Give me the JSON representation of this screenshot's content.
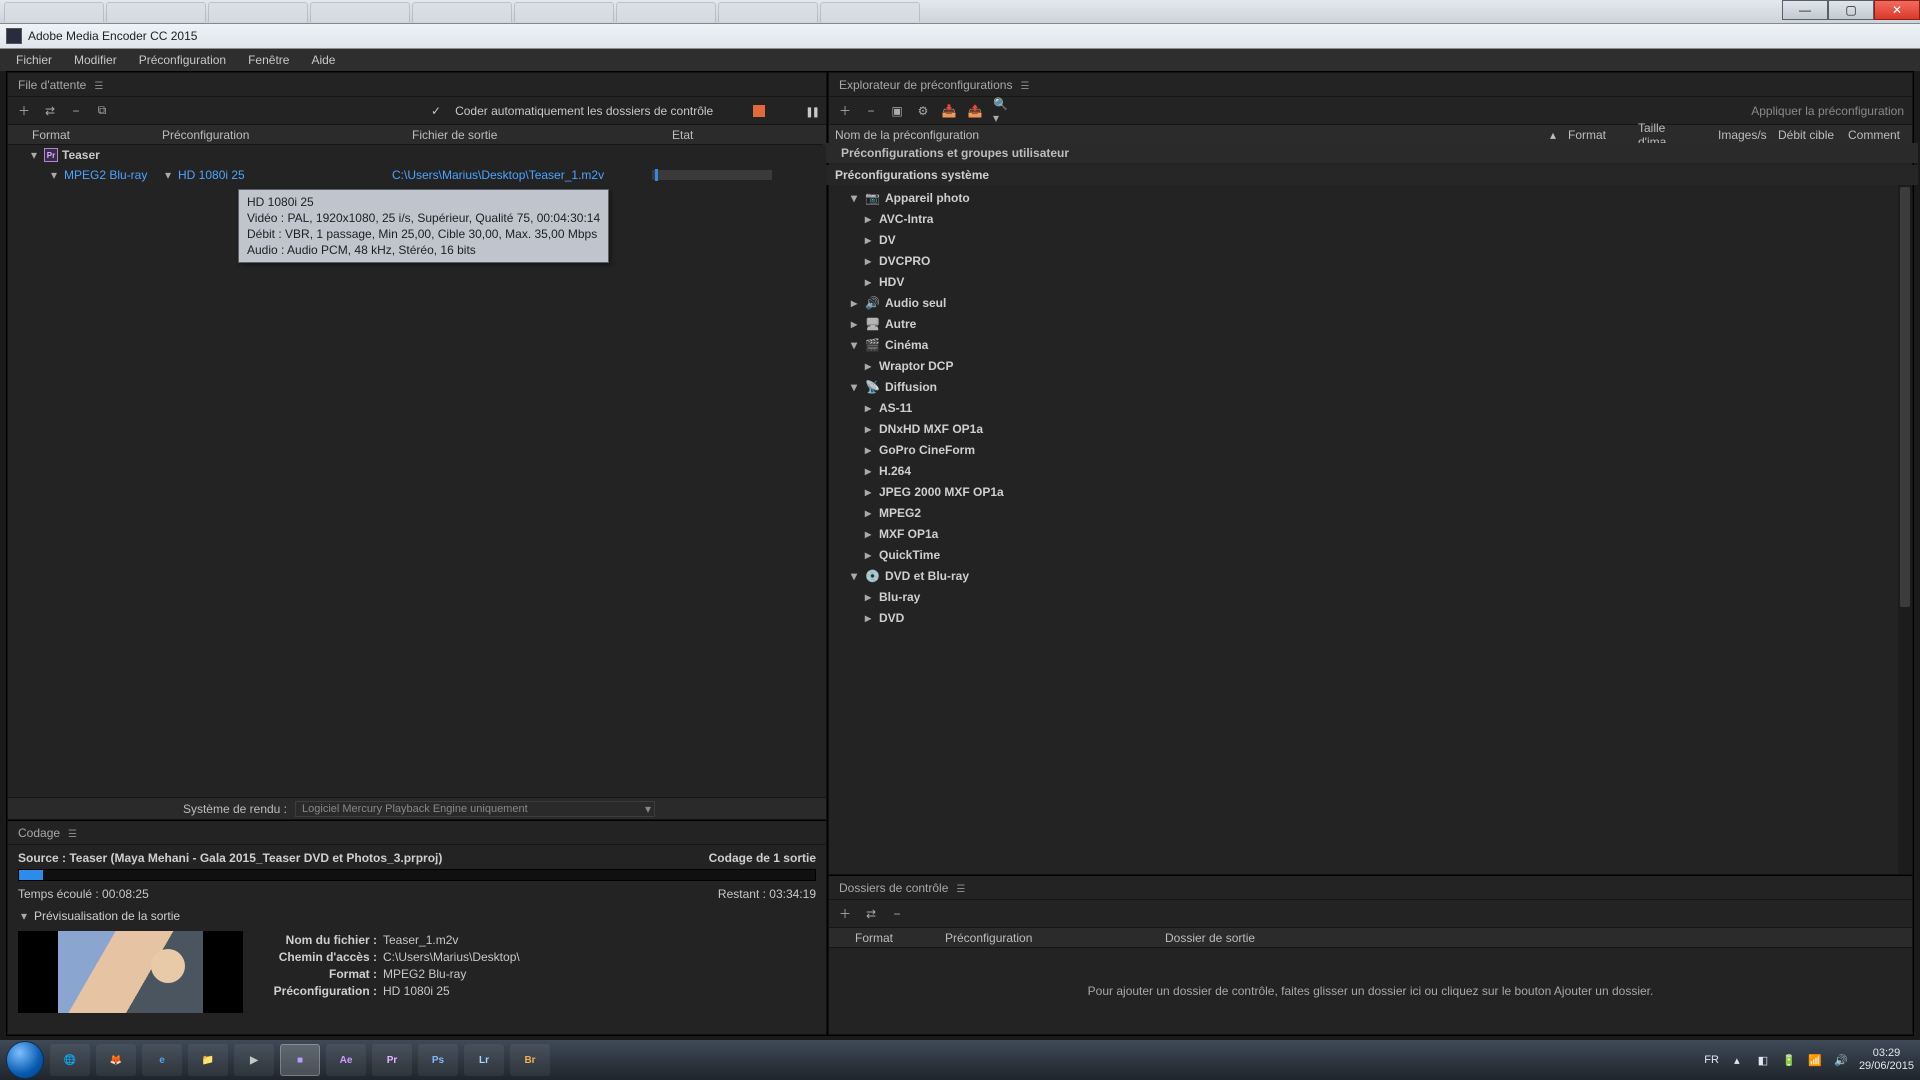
{
  "titlebar": {
    "title": "Adobe Media Encoder CC 2015"
  },
  "menubar": {
    "items": [
      "Fichier",
      "Modifier",
      "Préconfiguration",
      "Fenêtre",
      "Aide"
    ]
  },
  "queue": {
    "panel_title": "File d'attente",
    "auto_encode_label": "Coder automatiquement les dossiers de contrôle",
    "columns": {
      "format": "Format",
      "preset": "Préconfiguration",
      "output": "Fichier de sortie",
      "state": "Etat"
    },
    "item": {
      "name": "Teaser",
      "format": "MPEG2 Blu-ray",
      "preset": "HD 1080i 25",
      "output": "C:\\Users\\Marius\\Desktop\\Teaser_1.m2v"
    },
    "tooltip": {
      "l1": "HD 1080i 25",
      "l2": "Vidéo : PAL, 1920x1080, 25 i/s, Supérieur, Qualité  75, 00:04:30:14",
      "l3": "Débit : VBR, 1 passage, Min 25,00, Cible 30,00, Max. 35,00 Mbps",
      "l4": "Audio : Audio PCM, 48 kHz, Stéréo, 16 bits"
    },
    "render_label": "Système de rendu :",
    "render_value": "Logiciel Mercury Playback Engine uniquement"
  },
  "encoding": {
    "panel_title": "Codage",
    "source": "Source : Teaser (Maya Mehani - Gala 2015_Teaser DVD et Photos_3.prproj)",
    "count": "Codage de 1 sortie",
    "elapsed_label": "Temps écoulé : ",
    "elapsed_value": "00:08:25",
    "remaining_label": "Restant : ",
    "remaining_value": "03:34:19",
    "preview_label": "Prévisualisation de la sortie",
    "meta": {
      "filename_k": "Nom du fichier :",
      "filename_v": "Teaser_1.m2v",
      "path_k": "Chemin d'accès :",
      "path_v": "C:\\Users\\Marius\\Desktop\\",
      "format_k": "Format :",
      "format_v": "MPEG2 Blu-ray",
      "preset_k": "Préconfiguration :",
      "preset_v": "HD 1080i 25"
    }
  },
  "presets": {
    "panel_title": "Explorateur de préconfigurations",
    "apply_label": "Appliquer la préconfiguration",
    "columns": {
      "name": "Nom de la préconfiguration",
      "format": "Format",
      "size": "Taille d'ima…",
      "fps": "Images/s",
      "rate": "Débit cible",
      "comment": "Comment"
    },
    "user_group": "Préconfigurations et groupes utilisateur",
    "system_group": "Préconfigurations système",
    "tree": {
      "camera": "Appareil photo",
      "camera_children": [
        "AVC-Intra",
        "DV",
        "DVCPRO",
        "HDV"
      ],
      "audio": "Audio seul",
      "other": "Autre",
      "cinema": "Cinéma",
      "cinema_children": [
        "Wraptor DCP"
      ],
      "broadcast": "Diffusion",
      "broadcast_children": [
        "AS-11",
        "DNxHD MXF OP1a",
        "GoPro CineForm",
        "H.264",
        "JPEG 2000 MXF OP1a",
        "MPEG2",
        "MXF OP1a",
        "QuickTime"
      ],
      "dvd": "DVD et Blu-ray",
      "dvd_children": [
        "Blu-ray",
        "DVD"
      ]
    }
  },
  "watch": {
    "panel_title": "Dossiers de contrôle",
    "columns": {
      "format": "Format",
      "preset": "Préconfiguration",
      "output": "Dossier de sortie"
    },
    "empty": "Pour ajouter un dossier de contrôle, faites glisser un dossier ici ou cliquez sur le bouton Ajouter un dossier."
  },
  "tray": {
    "lang": "FR",
    "time": "03:29",
    "date": "29/06/2015"
  }
}
